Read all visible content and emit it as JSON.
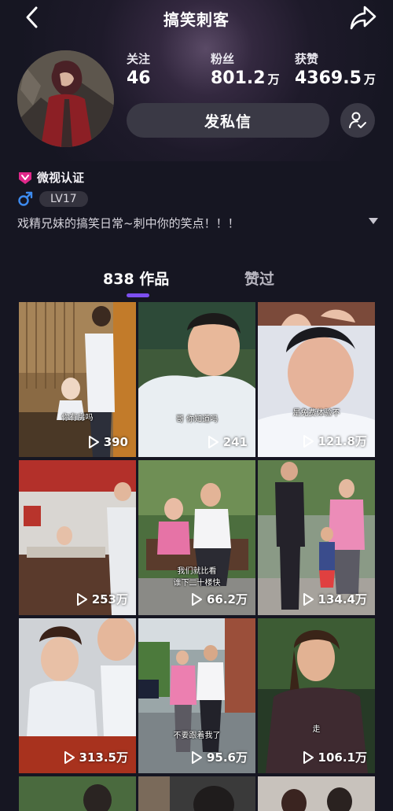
{
  "header": {
    "title": "搞笑刺客",
    "back_icon": "chevron-left-icon",
    "share_icon": "share-arrow-icon"
  },
  "profile": {
    "stats": [
      {
        "label": "关注",
        "value": "46",
        "unit": ""
      },
      {
        "label": "粉丝",
        "value": "801.2",
        "unit": "万"
      },
      {
        "label": "获赞",
        "value": "4369.5",
        "unit": "万"
      }
    ],
    "message_button": "发私信",
    "follow_icon": "add-friend-icon",
    "verification": "微视认证",
    "level": "LV17",
    "bio": "戏精兄妹的搞笑日常~刺中你的笑点！！！"
  },
  "tabs": [
    {
      "label": "838 作品",
      "active": true
    },
    {
      "label": "赞过",
      "active": false
    }
  ],
  "videos": [
    {
      "caption": "你有房吗",
      "plays": "390"
    },
    {
      "caption": "哥  你知道吗",
      "plays": "241"
    },
    {
      "caption": "是免费体验不",
      "plays": "121.8万"
    },
    {
      "caption": "",
      "plays": "253万"
    },
    {
      "caption": "我们就比看\n谁下二十楼快",
      "plays": "66.2万"
    },
    {
      "caption": "",
      "plays": "134.4万"
    },
    {
      "caption": "",
      "plays": "313.5万"
    },
    {
      "caption": "不要跟着我了",
      "plays": "95.6万"
    },
    {
      "caption": "走",
      "plays": "106.1万"
    }
  ],
  "colors": {
    "background": "#161622",
    "accent": "#7d4ff0",
    "button": "#3a3945",
    "verify": "#e0288a",
    "gender": "#3d8bf0"
  }
}
